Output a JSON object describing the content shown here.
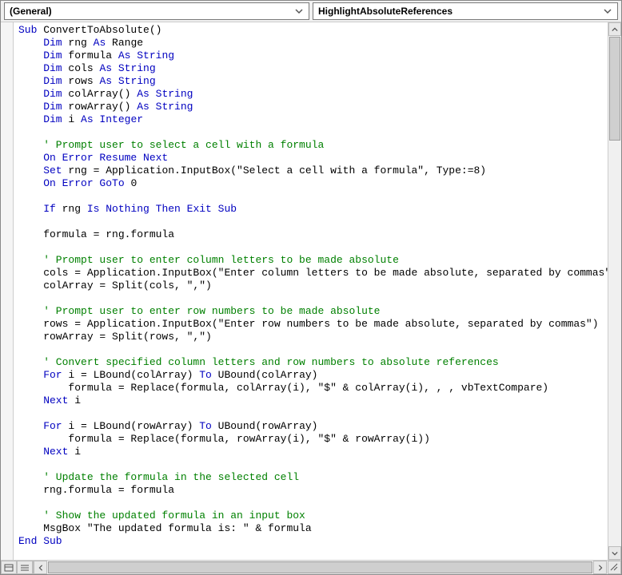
{
  "dropdowns": {
    "object": "(General)",
    "procedure": "HighlightAbsoluteReferences"
  },
  "code": {
    "tokens": [
      [
        [
          "kw",
          "Sub "
        ],
        [
          "tx",
          "ConvertToAbsolute()"
        ]
      ],
      [
        [
          "kw",
          "    Dim "
        ],
        [
          "tx",
          "rng "
        ],
        [
          "kw",
          "As "
        ],
        [
          "tx",
          "Range"
        ]
      ],
      [
        [
          "kw",
          "    Dim "
        ],
        [
          "tx",
          "formula "
        ],
        [
          "kw",
          "As String"
        ]
      ],
      [
        [
          "kw",
          "    Dim "
        ],
        [
          "tx",
          "cols "
        ],
        [
          "kw",
          "As String"
        ]
      ],
      [
        [
          "kw",
          "    Dim "
        ],
        [
          "tx",
          "rows "
        ],
        [
          "kw",
          "As String"
        ]
      ],
      [
        [
          "kw",
          "    Dim "
        ],
        [
          "tx",
          "colArray() "
        ],
        [
          "kw",
          "As String"
        ]
      ],
      [
        [
          "kw",
          "    Dim "
        ],
        [
          "tx",
          "rowArray() "
        ],
        [
          "kw",
          "As String"
        ]
      ],
      [
        [
          "kw",
          "    Dim "
        ],
        [
          "tx",
          "i "
        ],
        [
          "kw",
          "As Integer"
        ]
      ],
      [
        [
          "tx",
          ""
        ]
      ],
      [
        [
          "cm",
          "    ' Prompt user to select a cell with a formula"
        ]
      ],
      [
        [
          "kw",
          "    On Error Resume Next"
        ]
      ],
      [
        [
          "kw",
          "    Set "
        ],
        [
          "tx",
          "rng = Application.InputBox(\"Select a cell with a formula\", Type:=8)"
        ]
      ],
      [
        [
          "kw",
          "    On Error GoTo "
        ],
        [
          "tx",
          "0"
        ]
      ],
      [
        [
          "tx",
          ""
        ]
      ],
      [
        [
          "kw",
          "    If "
        ],
        [
          "tx",
          "rng "
        ],
        [
          "kw",
          "Is Nothing Then Exit Sub"
        ]
      ],
      [
        [
          "tx",
          ""
        ]
      ],
      [
        [
          "tx",
          "    formula = rng.formula"
        ]
      ],
      [
        [
          "tx",
          ""
        ]
      ],
      [
        [
          "cm",
          "    ' Prompt user to enter column letters to be made absolute"
        ]
      ],
      [
        [
          "tx",
          "    cols = Application.InputBox(\"Enter column letters to be made absolute, separated by commas\")"
        ]
      ],
      [
        [
          "tx",
          "    colArray = Split(cols, \",\")"
        ]
      ],
      [
        [
          "tx",
          ""
        ]
      ],
      [
        [
          "cm",
          "    ' Prompt user to enter row numbers to be made absolute"
        ]
      ],
      [
        [
          "tx",
          "    rows = Application.InputBox(\"Enter row numbers to be made absolute, separated by commas\")"
        ]
      ],
      [
        [
          "tx",
          "    rowArray = Split(rows, \",\")"
        ]
      ],
      [
        [
          "tx",
          ""
        ]
      ],
      [
        [
          "cm",
          "    ' Convert specified column letters and row numbers to absolute references"
        ]
      ],
      [
        [
          "kw",
          "    For "
        ],
        [
          "tx",
          "i = LBound(colArray) "
        ],
        [
          "kw",
          "To "
        ],
        [
          "tx",
          "UBound(colArray)"
        ]
      ],
      [
        [
          "tx",
          "        formula = Replace(formula, colArray(i), \"$\" & colArray(i), , , vbTextCompare)"
        ]
      ],
      [
        [
          "kw",
          "    Next "
        ],
        [
          "tx",
          "i"
        ]
      ],
      [
        [
          "tx",
          ""
        ]
      ],
      [
        [
          "kw",
          "    For "
        ],
        [
          "tx",
          "i = LBound(rowArray) "
        ],
        [
          "kw",
          "To "
        ],
        [
          "tx",
          "UBound(rowArray)"
        ]
      ],
      [
        [
          "tx",
          "        formula = Replace(formula, rowArray(i), \"$\" & rowArray(i))"
        ]
      ],
      [
        [
          "kw",
          "    Next "
        ],
        [
          "tx",
          "i"
        ]
      ],
      [
        [
          "tx",
          ""
        ]
      ],
      [
        [
          "cm",
          "    ' Update the formula in the selected cell"
        ]
      ],
      [
        [
          "tx",
          "    rng.formula = formula"
        ]
      ],
      [
        [
          "tx",
          ""
        ]
      ],
      [
        [
          "cm",
          "    ' Show the updated formula in an input box"
        ]
      ],
      [
        [
          "tx",
          "    MsgBox \"The updated formula is: \" & formula"
        ]
      ],
      [
        [
          "kw",
          "End Sub"
        ]
      ]
    ]
  }
}
